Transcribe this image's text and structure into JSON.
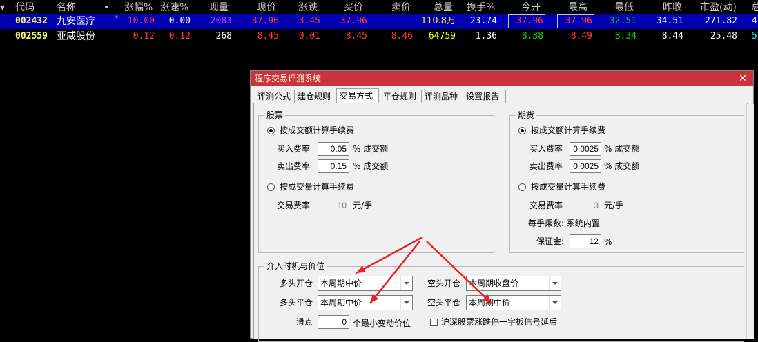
{
  "quote": {
    "headers": [
      "代码",
      "名称",
      "•",
      "涨幅%",
      "涨速%",
      "现量",
      "现价",
      "涨跌",
      "买价",
      "卖价",
      "总量",
      "换手%",
      "今开",
      "最高",
      "最低",
      "昨收",
      "市盈(动)",
      "总"
    ],
    "rows": [
      {
        "code": "002432",
        "name": "九安医疗",
        "flag": "*",
        "pct": "10.00",
        "speed": "0.00",
        "vol_now": "2083",
        "price": "37.96",
        "change": "3.45",
        "bid": "37.96",
        "ask": "–",
        "total": "110.8万",
        "turnover": "23.74",
        "open": "37.96",
        "high": "37.96",
        "low": "32.51",
        "prev": "34.51",
        "pe": "271.82",
        "extra": "4"
      },
      {
        "code": "002559",
        "name": "亚威股份",
        "flag": "",
        "pct": "0.12",
        "speed": "0.12",
        "vol_now": "268",
        "price": "8.45",
        "change": "0.01",
        "bid": "8.45",
        "ask": "8.46",
        "total": "64759",
        "turnover": "1.36",
        "open": "8.38",
        "high": "8.49",
        "low": "8.34",
        "prev": "8.44",
        "pe": "25.48",
        "extra": "5"
      }
    ],
    "colors": {
      "up": "#ff3b3b",
      "down": "#00e000",
      "code": "#ffff66",
      "white": "#ffffff",
      "purple": "#cc44ff",
      "yellow": "#ffff00",
      "cyan": "#00ffff",
      "header": "#c8c8c8",
      "row_select": "#0000b0"
    }
  },
  "dialog": {
    "title": "程序交易评测系统",
    "close": "✕",
    "tabs": [
      "评测公式",
      "建仓规则",
      "交易方式",
      "平仓规则",
      "评测品种",
      "设置报告"
    ],
    "active_tab": "交易方式",
    "stock": {
      "group": "股票",
      "by_amount": "按成交额计算手续费",
      "buy_label": "买入费率",
      "buy_value": "0.05",
      "buy_unit": "% 成交额",
      "sell_label": "卖出费率",
      "sell_value": "0.15",
      "sell_unit": "% 成交额",
      "by_volume": "按成交量计算手续费",
      "fee_label": "交易费率",
      "fee_value": "10",
      "fee_unit": "元/手"
    },
    "futures": {
      "group": "期货",
      "by_amount": "按成交额计算手续费",
      "buy_label": "买入费率",
      "buy_value": "0.0025",
      "buy_unit": "% 成交额",
      "sell_label": "卖出费率",
      "sell_value": "0.0025",
      "sell_unit": "% 成交额",
      "by_volume": "按成交量计算手续费",
      "fee_label": "交易费率",
      "fee_value": "3",
      "fee_unit": "元/手",
      "multiplier": "每手乘数: 系统内置",
      "margin_label": "保证金:",
      "margin_value": "12",
      "margin_unit": "%"
    },
    "timing": {
      "group": "介入时机与价位",
      "long_open_label": "多头开仓",
      "long_open_value": "本周期中价",
      "long_close_label": "多头平仓",
      "long_close_value": "本周期中价",
      "short_open_label": "空头开仓",
      "short_open_value": "本周期收盘价",
      "short_close_label": "空头平仓",
      "short_close_value": "本周期中价",
      "slip_label": "滑点",
      "slip_value": "0",
      "slip_unit": "个最小变动价位",
      "delay_label": "沪深股票涨跌停一字板信号延后"
    },
    "annotation_color": "#e8202a"
  }
}
